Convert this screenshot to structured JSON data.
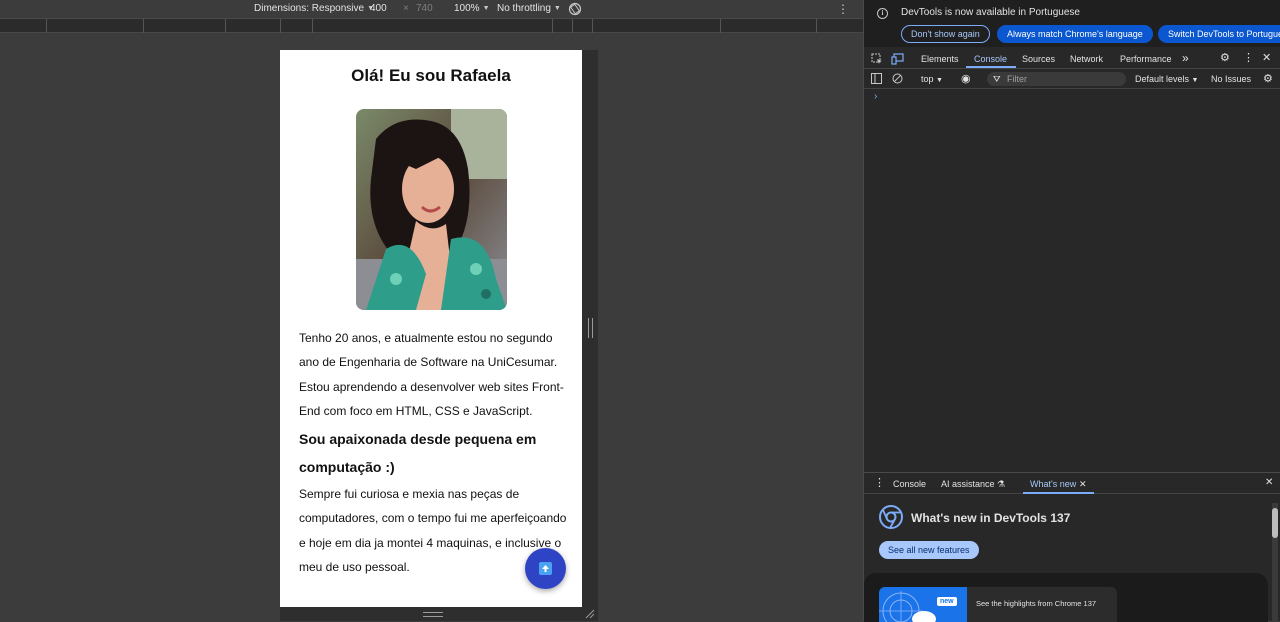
{
  "device_toolbar": {
    "dimensions_label": "Dimensions: Responsive",
    "width_value": "400",
    "times_sign": "×",
    "height_value": "740",
    "zoom": "100%",
    "throttling": "No throttling"
  },
  "page": {
    "title": "Olá! Eu sou Rafaela",
    "paragraph1": "Tenho 20 anos, e atualmente estou no segundo ano de Engenharia de Software na UniCesumar. Estou aprendendo a desenvolver web sites Front-End com foco em HTML, CSS e JavaScript.",
    "subheading": "Sou apaixonada desde pequena em computação :)",
    "paragraph2": "Sempre fui curiosa e mexia nas peças de computadores, com o tempo fui me aperfeiçoando e hoje em dia ja montei 4 maquinas, e inclusive o meu de uso pessoal."
  },
  "devtools": {
    "infobar": {
      "message": "DevTools is now available in Portuguese",
      "dont_show": "Don't show again",
      "match_language": "Always match Chrome's language",
      "switch_language": "Switch DevTools to Portuguese"
    },
    "tabs": [
      "Elements",
      "Console",
      "Sources",
      "Network",
      "Performance"
    ],
    "active_tab": "Console",
    "console_toolbar": {
      "context": "top",
      "filter_placeholder": "Filter",
      "levels": "Default levels",
      "issues": "No Issues"
    },
    "drawer": {
      "tabs": [
        "Console",
        "AI assistance",
        "What's new"
      ],
      "active_tab": "What's new",
      "whats_new_title": "What's new in DevTools 137",
      "see_all": "See all new features",
      "card_badge": "new",
      "card_text": "See the highlights from Chrome 137"
    }
  },
  "colors": {
    "accent_blue": "#7cacf8",
    "button_blue": "#0b57d0",
    "fab_blue": "#2f44c4",
    "devtools_bg": "#282828"
  }
}
